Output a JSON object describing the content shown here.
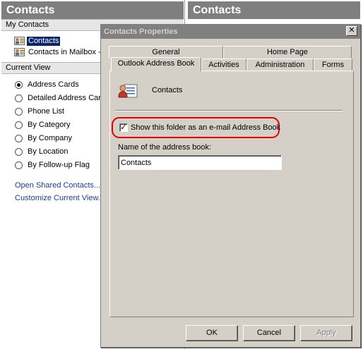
{
  "nav": {
    "title": "Contacts",
    "my_contacts_header": "My Contacts",
    "folders": [
      {
        "label": "Contacts",
        "selected": true,
        "icon": "contacts-folder-icon"
      },
      {
        "label": "Contacts in Mailbox - ",
        "selected": false,
        "icon": "contacts-folder-icon"
      }
    ],
    "current_view_header": "Current View",
    "views": [
      {
        "label": "Address Cards",
        "checked": true
      },
      {
        "label": "Detailed Address Cards",
        "checked": false
      },
      {
        "label": "Phone List",
        "checked": false
      },
      {
        "label": "By Category",
        "checked": false
      },
      {
        "label": "By Company",
        "checked": false
      },
      {
        "label": "By Location",
        "checked": false
      },
      {
        "label": "By Follow-up Flag",
        "checked": false
      }
    ],
    "links": [
      "Open Shared Contacts...",
      "Customize Current View..."
    ]
  },
  "right_pane": {
    "title": "Contacts"
  },
  "dialog": {
    "title": "Contacts Properties",
    "close_label": "✕",
    "tabs_back_row": [
      "General",
      "Home Page"
    ],
    "tabs_front_row": [
      "Outlook Address Book",
      "Activities",
      "Administration",
      "Forms"
    ],
    "active_tab": "Outlook Address Book",
    "folder_name": "Contacts",
    "checkbox_label": "Show this folder as an e-mail Address Book",
    "checkbox_checked": true,
    "name_field_label": "Name of the address book:",
    "name_field_value": "Contacts",
    "buttons": {
      "ok": "OK",
      "cancel": "Cancel",
      "apply": "Apply"
    }
  },
  "colors": {
    "pane_header": "#7f7f7f",
    "dialog_face": "#d4d0c8",
    "selection": "#0a246a",
    "link": "#1f3a93",
    "highlight_ring": "#e00000"
  }
}
